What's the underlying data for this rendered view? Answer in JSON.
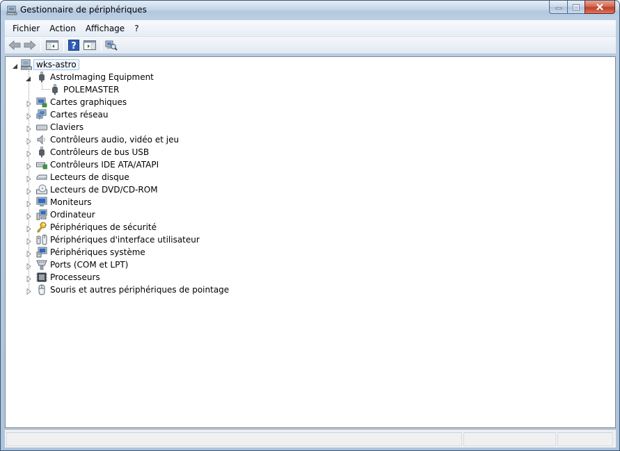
{
  "window": {
    "title": "Gestionnaire de périphériques"
  },
  "menu": {
    "items": [
      "Fichier",
      "Action",
      "Affichage",
      "?"
    ]
  },
  "toolbar": {
    "buttons": [
      "back-arrow-icon",
      "forward-arrow-icon",
      "show-hide-console-tree-icon",
      "help-icon",
      "properties-pane-icon",
      "scan-hardware-icon"
    ]
  },
  "tree": {
    "root": "wks-astro",
    "expanded_category": "AstroImaging Equipment",
    "expanded_child": "POLEMASTER",
    "categories": [
      {
        "label": "Cartes graphiques",
        "icon": "display-adapter-icon"
      },
      {
        "label": "Cartes réseau",
        "icon": "network-adapter-icon"
      },
      {
        "label": "Claviers",
        "icon": "keyboard-icon"
      },
      {
        "label": "Contrôleurs audio, vidéo et jeu",
        "icon": "speaker-icon"
      },
      {
        "label": "Contrôleurs de bus USB",
        "icon": "usb-plug-icon"
      },
      {
        "label": "Contrôleurs IDE ATA/ATAPI",
        "icon": "ide-controller-icon"
      },
      {
        "label": "Lecteurs de disque",
        "icon": "disk-drive-icon"
      },
      {
        "label": "Lecteurs de DVD/CD-ROM",
        "icon": "dvd-drive-icon"
      },
      {
        "label": "Moniteurs",
        "icon": "monitor-icon"
      },
      {
        "label": "Ordinateur",
        "icon": "computer-icon"
      },
      {
        "label": "Périphériques de sécurité",
        "icon": "security-key-icon"
      },
      {
        "label": "Périphériques d'interface utilisateur",
        "icon": "hid-icon"
      },
      {
        "label": "Périphériques système",
        "icon": "system-devices-icon"
      },
      {
        "label": "Ports (COM et LPT)",
        "icon": "port-icon"
      },
      {
        "label": "Processeurs",
        "icon": "processor-icon"
      },
      {
        "label": "Souris et autres périphériques de pointage",
        "icon": "mouse-icon"
      }
    ]
  }
}
